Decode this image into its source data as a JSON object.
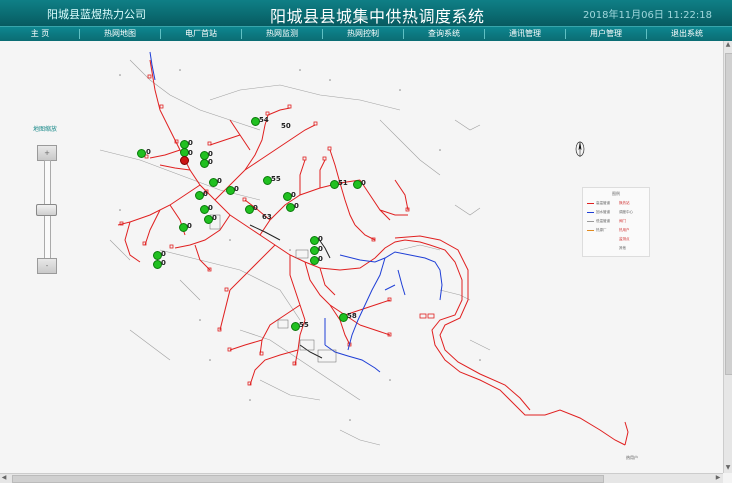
{
  "header": {
    "company": "阳城县蓝煜热力公司",
    "title": "阳城县县城集中供热调度系统",
    "datetime": "2018年11月06日  11:22:18"
  },
  "menu": [
    "主  页",
    "热网地图",
    "电厂首站",
    "热网监测",
    "热网控制",
    "查询系统",
    "通讯管理",
    "用户管理",
    "退出系统"
  ],
  "zoom": {
    "label": "地图缩放",
    "plus": "+",
    "minus": "-",
    "level": 0.5
  },
  "legend": {
    "title": "图例",
    "items": [
      "高温管道",
      "回水管道",
      "低温管道",
      "热源厂",
      "换热站",
      "调度中心",
      "阀门",
      "热用户",
      "监测点",
      "其他"
    ]
  },
  "map_labels": {
    "end_label": "热用户",
    "n50": "50",
    "n54": "54",
    "n55a": "55",
    "n51": "51",
    "n63": "63",
    "n55b": "55",
    "n58": "58"
  },
  "stations": [
    {
      "status": "normal",
      "label": "0"
    },
    {
      "status": "normal",
      "label": "0"
    },
    {
      "status": "alarm",
      "label": "0"
    },
    {
      "status": "normal",
      "label": "0"
    },
    {
      "status": "normal",
      "label": "0"
    },
    {
      "status": "normal",
      "label": "0"
    },
    {
      "status": "normal",
      "label": "0"
    },
    {
      "status": "normal",
      "label": "0"
    },
    {
      "status": "normal",
      "label": "0"
    },
    {
      "status": "normal",
      "label": "0"
    },
    {
      "status": "normal",
      "label": "0"
    },
    {
      "status": "normal",
      "label": "0"
    },
    {
      "status": "normal",
      "label": "0"
    },
    {
      "status": "normal",
      "label": "0"
    },
    {
      "status": "normal",
      "label": "0"
    },
    {
      "status": "normal",
      "label": "0"
    },
    {
      "status": "normal",
      "label": "0"
    },
    {
      "status": "normal",
      "label": "0"
    },
    {
      "status": "normal",
      "label": "0"
    },
    {
      "status": "normal",
      "label": "0"
    },
    {
      "status": "normal",
      "label": "0"
    },
    {
      "status": "normal",
      "label": "0"
    },
    {
      "status": "normal",
      "label": "0"
    }
  ],
  "colors": {
    "supply": "#e02020",
    "return": "#1f3fd6",
    "hot": "#e02020",
    "road": "#999999"
  }
}
